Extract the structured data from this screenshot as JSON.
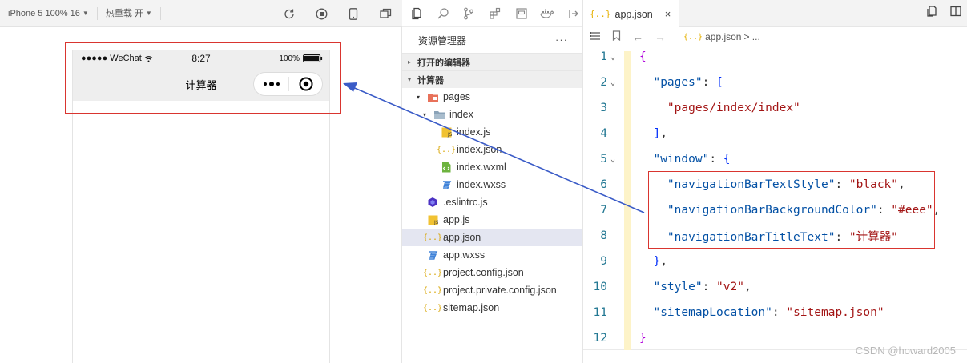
{
  "simulator": {
    "device_label": "iPhone 5 100% 16",
    "hot_reload_label": "热重载 开",
    "status_bar": {
      "carrier": "●●●●● WeChat",
      "time": "8:27",
      "battery_pct": "100%"
    },
    "nav_title": "计算器"
  },
  "explorer": {
    "header": "资源管理器",
    "more": "···",
    "open_editors": "打开的编辑器",
    "project": "计算器",
    "tree": [
      {
        "label": "pages",
        "icon": "folder-pages-icon",
        "depth": 1,
        "chev": "▾"
      },
      {
        "label": "index",
        "icon": "folder-icon",
        "depth": 2,
        "chev": "▾"
      },
      {
        "label": "index.js",
        "icon": "js-file-icon",
        "depth": 3
      },
      {
        "label": "index.json",
        "icon": "json-file-icon",
        "depth": 3
      },
      {
        "label": "index.wxml",
        "icon": "wxml-file-icon",
        "depth": 3
      },
      {
        "label": "index.wxss",
        "icon": "css-file-icon",
        "depth": 3
      },
      {
        "label": ".eslintrc.js",
        "icon": "eslint-file-icon",
        "depth": 1
      },
      {
        "label": "app.js",
        "icon": "js-file-icon",
        "depth": 1
      },
      {
        "label": "app.json",
        "icon": "json-file-icon",
        "depth": 1,
        "selected": true
      },
      {
        "label": "app.wxss",
        "icon": "css-file-icon",
        "depth": 1
      },
      {
        "label": "project.config.json",
        "icon": "json-file-icon",
        "depth": 1
      },
      {
        "label": "project.private.config.json",
        "icon": "json-file-icon",
        "depth": 1
      },
      {
        "label": "sitemap.json",
        "icon": "json-file-icon",
        "depth": 1
      }
    ]
  },
  "editor": {
    "tab_label": "app.json",
    "tab_close": "×",
    "breadcrumb_file": "app.json",
    "breadcrumb_rest": "> ...",
    "lines": [
      {
        "n": "1",
        "fold": "⌄",
        "parts": [
          [
            "brk",
            "{"
          ]
        ]
      },
      {
        "n": "2",
        "fold": "⌄",
        "parts": [
          [
            "key",
            "  \"pages\""
          ],
          [
            "punc",
            ": "
          ],
          [
            "brk2",
            "["
          ]
        ]
      },
      {
        "n": "3",
        "parts": [
          [
            "str",
            "    \"pages/index/index\""
          ]
        ]
      },
      {
        "n": "4",
        "parts": [
          [
            "brk2",
            "  ]"
          ],
          [
            "punc",
            ","
          ]
        ]
      },
      {
        "n": "5",
        "fold": "⌄",
        "parts": [
          [
            "key",
            "  \"window\""
          ],
          [
            "punc",
            ": "
          ],
          [
            "brk2",
            "{"
          ]
        ]
      },
      {
        "n": "6",
        "parts": [
          [
            "key",
            "    \"navigationBarTextStyle\""
          ],
          [
            "punc",
            ": "
          ],
          [
            "str",
            "\"black\""
          ],
          [
            "punc",
            ","
          ]
        ]
      },
      {
        "n": "7",
        "parts": [
          [
            "key",
            "    \"navigationBarBackgroundColor\""
          ],
          [
            "punc",
            ": "
          ],
          [
            "str",
            "\"#eee\""
          ],
          [
            "punc",
            ","
          ]
        ]
      },
      {
        "n": "8",
        "parts": [
          [
            "key",
            "    \"navigationBarTitleText\""
          ],
          [
            "punc",
            ": "
          ],
          [
            "str",
            "\"计算器\""
          ]
        ]
      },
      {
        "n": "9",
        "parts": [
          [
            "brk2",
            "  }"
          ],
          [
            "punc",
            ","
          ]
        ]
      },
      {
        "n": "10",
        "parts": [
          [
            "key",
            "  \"style\""
          ],
          [
            "punc",
            ": "
          ],
          [
            "str",
            "\"v2\""
          ],
          [
            "punc",
            ","
          ]
        ]
      },
      {
        "n": "11",
        "parts": [
          [
            "key",
            "  \"sitemapLocation\""
          ],
          [
            "punc",
            ": "
          ],
          [
            "str",
            "\"sitemap.json\""
          ]
        ]
      },
      {
        "n": "12",
        "parts": [
          [
            "brk",
            "}"
          ]
        ]
      }
    ]
  },
  "watermark": "CSDN @howard2005",
  "colors": {
    "annotation_red": "#d9352f",
    "arrow_blue": "#3a5bc7",
    "nav_bg": "#eeeeee",
    "selection": "#e4e6f1"
  }
}
